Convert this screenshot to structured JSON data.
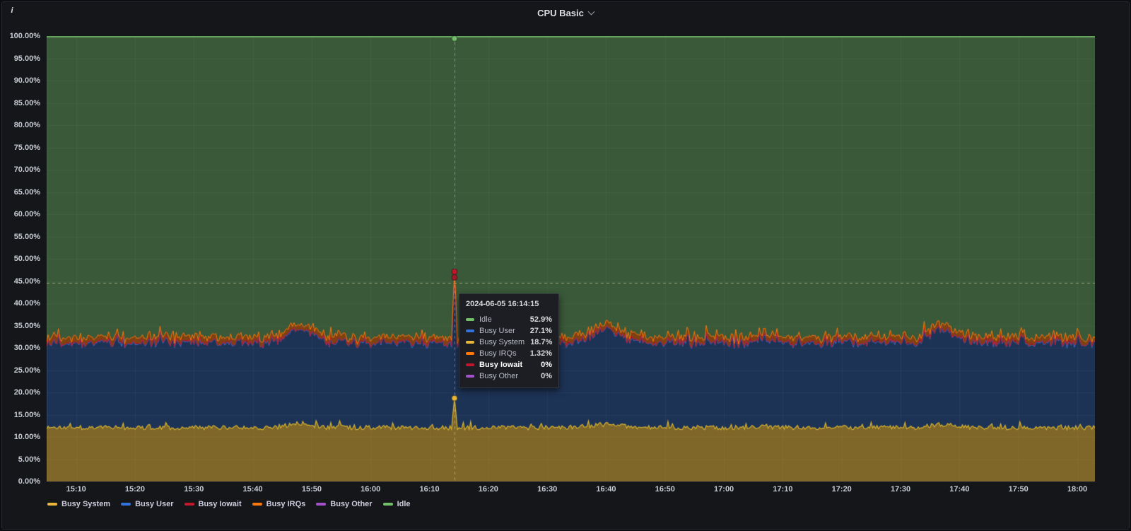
{
  "panel": {
    "title": "CPU Basic",
    "info_icon_label": "i"
  },
  "chart_data": {
    "type": "area",
    "stacked": true,
    "title": "CPU Basic",
    "ylim": [
      0,
      100
    ],
    "y_tick_labels": [
      "0.00%",
      "5.00%",
      "10.00%",
      "15.00%",
      "20.00%",
      "25.00%",
      "30.00%",
      "35.00%",
      "40.00%",
      "45.00%",
      "50.00%",
      "55.00%",
      "60.00%",
      "65.00%",
      "70.00%",
      "75.00%",
      "80.00%",
      "85.00%",
      "90.00%",
      "95.00%",
      "100.00%"
    ],
    "x_ticks": [
      {
        "label": "15:10",
        "min": 910
      },
      {
        "label": "15:20",
        "min": 920
      },
      {
        "label": "15:30",
        "min": 930
      },
      {
        "label": "15:40",
        "min": 940
      },
      {
        "label": "15:50",
        "min": 950
      },
      {
        "label": "16:00",
        "min": 960
      },
      {
        "label": "16:10",
        "min": 970
      },
      {
        "label": "16:20",
        "min": 980
      },
      {
        "label": "16:30",
        "min": 990
      },
      {
        "label": "16:40",
        "min": 1000
      },
      {
        "label": "16:50",
        "min": 1010
      },
      {
        "label": "17:00",
        "min": 1020
      },
      {
        "label": "17:10",
        "min": 1030
      },
      {
        "label": "17:20",
        "min": 1040
      },
      {
        "label": "17:30",
        "min": 1050
      },
      {
        "label": "17:40",
        "min": 1060
      },
      {
        "label": "17:50",
        "min": 1070
      },
      {
        "label": "18:00",
        "min": 1080
      }
    ],
    "time_start_min": 905,
    "time_end_min": 1083,
    "sample_step_min": 0.25,
    "noise_seed": 1337,
    "grid_color": "rgba(204,204,220,0.07)",
    "axis_color": "rgba(204,204,220,0.12)",
    "crosshair": {
      "t_min": 974.25,
      "time_label": "2024-06-05 16:14:15",
      "vline_color": "rgba(255,255,255,0.38)",
      "hline_value": 44.6,
      "hline_color": "rgba(225,225,175,0.55)"
    },
    "markers": [
      {
        "value": 100,
        "color": "#73bf69"
      },
      {
        "value": 47.12,
        "color": "#c4162a"
      },
      {
        "value": 45.8,
        "color": "#a3192b"
      },
      {
        "value": 18.7,
        "color": "#eab839"
      }
    ],
    "series": [
      {
        "name": "Busy System",
        "legend_color": "#eab839",
        "line_color": "#d9b430",
        "fill_color": "rgba(234,184,57,0.50)",
        "line_width": 1.2,
        "base": 12.1,
        "noise": 0.5,
        "jag_p": 0.12,
        "jag_h": 1.1,
        "min": 10.8,
        "bumps": [
          {
            "c": 948,
            "w": 2.0,
            "h": 1.0
          },
          {
            "c": 1000,
            "w": 2.5,
            "h": 0.7
          },
          {
            "c": 1057,
            "w": 2.0,
            "h": 0.7
          }
        ],
        "hover_value": 18.7,
        "hover_text": "18.7%"
      },
      {
        "name": "Busy User",
        "legend_color": "#3274d9",
        "line_color": "#3274d9",
        "fill_color": "rgba(50,116,217,0.32)",
        "line_width": 1,
        "base": 18.9,
        "noise": 0.7,
        "jag_p": 0.15,
        "jag_h": 1.7,
        "min": 17,
        "bumps": [
          {
            "c": 948,
            "w": 2.2,
            "h": 2.4
          },
          {
            "c": 1000,
            "w": 2.5,
            "h": 2.2
          },
          {
            "c": 1057,
            "w": 2.0,
            "h": 2.2
          }
        ],
        "hover_value": 27.1,
        "hover_text": "27.1%"
      },
      {
        "name": "Busy Iowait",
        "legend_color": "#c4162a",
        "line_color": "#c4162a",
        "fill_color": "rgba(196,22,42,0.45)",
        "line_width": 1,
        "base": 0.1,
        "noise": 0.22,
        "jag_p": 0.18,
        "jag_h": 0.55,
        "min": 0,
        "hover_value": 0,
        "hover_text": "0%"
      },
      {
        "name": "Busy IRQs",
        "legend_color": "#ff780a",
        "line_color": "#ff780a",
        "fill_color": "rgba(255,120,10,0.45)",
        "line_width": 1,
        "base": 1.15,
        "noise": 0.38,
        "jag_p": 0.12,
        "jag_h": 0.8,
        "min": 0.2,
        "hover_value": 1.32,
        "hover_text": "1.32%"
      },
      {
        "name": "Busy Other",
        "legend_color": "#a352cc",
        "line_color": "#a352cc",
        "fill_color": "rgba(163,82,204,0.45)",
        "line_width": 1,
        "no_line": true,
        "base": 0.04,
        "noise": 0.04,
        "min": 0,
        "hover_value": 0,
        "hover_text": "0%"
      },
      {
        "name": "Idle",
        "legend_color": "#73bf69",
        "line_color": "#73bf69",
        "fill_color": "rgba(115,191,105,0.40)",
        "line_width": 1.5,
        "remainder": true,
        "hover_value": 52.9,
        "hover_text": "52.9%"
      }
    ]
  },
  "tooltip": {
    "timestamp": "2024-06-05 16:14:15",
    "rows": [
      {
        "label": "Idle",
        "value": "52.9%",
        "color": "#73bf69",
        "bold": false
      },
      {
        "label": "Busy User",
        "value": "27.1%",
        "color": "#3274d9",
        "bold": false
      },
      {
        "label": "Busy System",
        "value": "18.7%",
        "color": "#eab839",
        "bold": false
      },
      {
        "label": "Busy IRQs",
        "value": "1.32%",
        "color": "#ff780a",
        "bold": false
      },
      {
        "label": "Busy Iowait",
        "value": "0%",
        "color": "#c4162a",
        "bold": true
      },
      {
        "label": "Busy Other",
        "value": "0%",
        "color": "#a352cc",
        "bold": false
      }
    ]
  },
  "legend": {
    "items": [
      {
        "label": "Busy System",
        "color": "#eab839"
      },
      {
        "label": "Busy User",
        "color": "#3274d9"
      },
      {
        "label": "Busy Iowait",
        "color": "#c4162a"
      },
      {
        "label": "Busy IRQs",
        "color": "#ff780a"
      },
      {
        "label": "Busy Other",
        "color": "#a352cc"
      },
      {
        "label": "Idle",
        "color": "#73bf69"
      }
    ]
  }
}
